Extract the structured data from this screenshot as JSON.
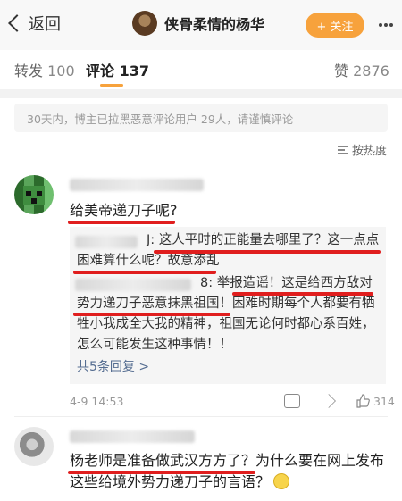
{
  "nav": {
    "back_label": "返回",
    "title": "侠骨柔情的杨华",
    "follow_label": "+ 关注"
  },
  "tabs": [
    {
      "label": "转发",
      "count": "100"
    },
    {
      "label": "评论",
      "count": "137"
    },
    {
      "label": "赞",
      "count": "2876"
    }
  ],
  "notice": "30天内，博主已拉黑恶意评论用户 29人，请谨慎评论",
  "sort_label": "按热度",
  "comments": [
    {
      "text": "给美帝递刀子呢?",
      "replies": [
        {
          "prefix": "J:",
          "text": "这人平时的正能量去哪里了？这一点点困难算什么呢？故意添乱"
        },
        {
          "prefix": "8:",
          "text": "举报造谣！这是给西方敌对势力递刀子恶意抹黑祖国！困难时期每个人都要有牺牲小我成全大我的精神，祖国无论何时都心系百姓，怎么可能发生这种事情！！"
        }
      ],
      "more_replies": "共5条回复 >",
      "date": "4-9 14:53",
      "likes": "314"
    },
    {
      "text": "杨老师是准备做武汉方方了？为什么要在网上发布这些给境外势力递刀子的言语？"
    }
  ],
  "colors": {
    "accent": "#f7a23c",
    "highlight_line": "#e01e1e",
    "link": "#556d91"
  },
  "icons": [
    "back-chevron-icon",
    "more-dots-icon",
    "sort-icon",
    "reply-icon",
    "share-icon",
    "like-icon",
    "smile-emoji-icon"
  ]
}
